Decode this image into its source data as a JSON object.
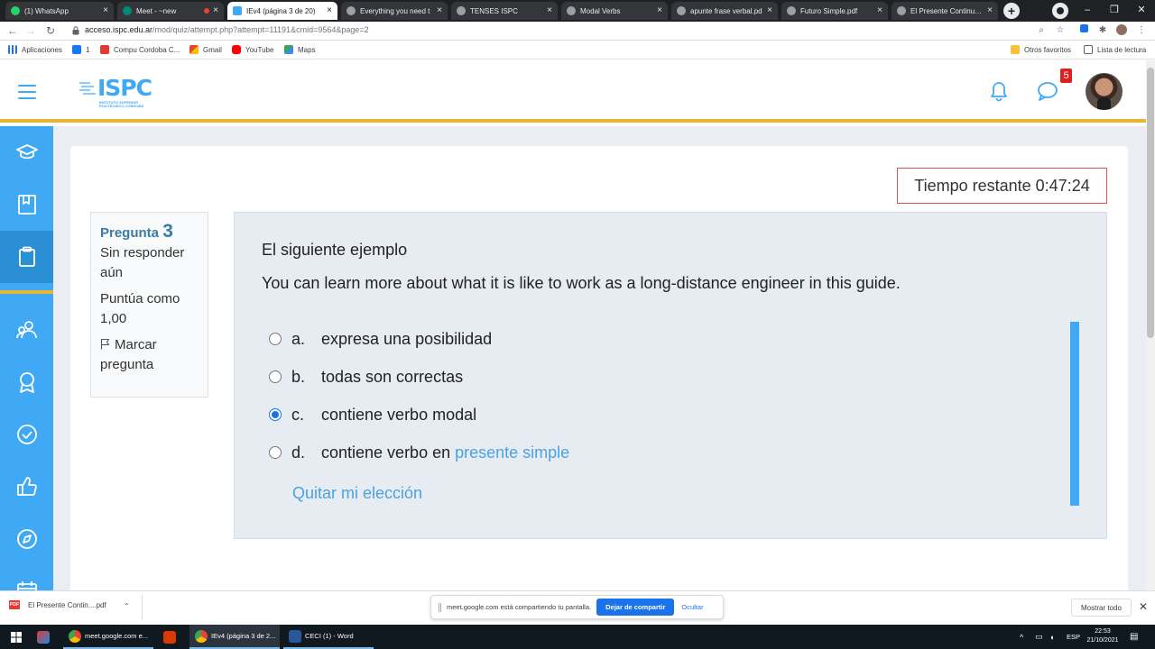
{
  "browser": {
    "tabs": [
      {
        "label": "(1) WhatsApp",
        "color": "#25d366",
        "active": false
      },
      {
        "label": "Meet - ~new",
        "color": "#00897b",
        "active": false,
        "recording": true
      },
      {
        "label": "IEv4 (página 3 de 20)",
        "color": "#3fa9f5",
        "active": true
      },
      {
        "label": "Everything you need t",
        "color": "#9aa0a6",
        "active": false
      },
      {
        "label": "TENSES ISPC",
        "color": "#9aa0a6",
        "active": false
      },
      {
        "label": "Modal Verbs",
        "color": "#9aa0a6",
        "active": false
      },
      {
        "label": "apunte frase verbal.pd",
        "color": "#9aa0a6",
        "active": false
      },
      {
        "label": "Futuro Simple.pdf",
        "color": "#9aa0a6",
        "active": false
      },
      {
        "label": "El Presente Continuo, p",
        "color": "#9aa0a6",
        "active": false
      }
    ],
    "url_host": "acceso.ispc.edu.ar",
    "url_path": "/mod/quiz/attempt.php?attempt=11191&cmid=9564&page=2",
    "bookmarks": [
      {
        "label": "Aplicaciones",
        "color": "#1a73e8"
      },
      {
        "label": "1",
        "color": "#1877f2"
      },
      {
        "label": "Compu Cordoba C...",
        "color": "#e53935"
      },
      {
        "label": "Gmail",
        "color": "#ea4335"
      },
      {
        "label": "YouTube",
        "color": "#ff0000"
      },
      {
        "label": "Maps",
        "color": "#34a853"
      }
    ],
    "other_bookmarks": "Otros favoritos",
    "reading_list": "Lista de lectura"
  },
  "site": {
    "logo_text": "ISPC",
    "logo_sub1": "INSTITUTO SUPERIOR",
    "logo_sub2": "POLITÉCNICO CÓRDOBA",
    "chat_badge": "5",
    "accent": "#3fa9f5",
    "gold": "#e7b531"
  },
  "sidebar": {
    "items": [
      {
        "name": "graduation-cap-icon"
      },
      {
        "name": "book-icon"
      },
      {
        "name": "clipboard-icon",
        "active": true
      },
      {
        "name": "users-icon"
      },
      {
        "name": "award-icon"
      },
      {
        "name": "badge-check-icon"
      },
      {
        "name": "thumbs-up-icon"
      },
      {
        "name": "compass-icon"
      },
      {
        "name": "calendar-icon"
      }
    ]
  },
  "quiz": {
    "timer_label": "Tiempo restante 0:47:24",
    "question_label": "Pregunta",
    "question_number": "3",
    "status": "Sin responder aún",
    "points": "Puntúa como 1,00",
    "flag_label": "Marcar pregunta",
    "prompt_line1": "El siguiente ejemplo",
    "prompt_line2": "You can learn more about what it is like to work as a long-distance engineer in this guide.",
    "options": [
      {
        "letter": "a.",
        "text": "expresa una posibilidad",
        "link": "",
        "checked": false
      },
      {
        "letter": "b.",
        "text": "todas son correctas",
        "link": "",
        "checked": false
      },
      {
        "letter": "c.",
        "text": "contiene verbo modal",
        "link": "",
        "checked": true
      },
      {
        "letter": "d.",
        "text": "contiene verbo en ",
        "link": "presente simple",
        "checked": false
      }
    ],
    "clear_choice": "Quitar mi elección"
  },
  "downloads": {
    "file": "El Presente Contin....pdf",
    "share_notice": "meet.google.com está compartiendo tu pantalla.",
    "stop_share": "Dejar de compartir",
    "hide": "Ocultar",
    "show_all": "Mostrar todo"
  },
  "taskbar": {
    "apps": [
      {
        "label": "meet.google.com e...",
        "color": "#fbbc04"
      },
      {
        "label": "IEv4 (página 3 de 2...",
        "color": "#fbbc04"
      },
      {
        "label": "CECI (1) - Word",
        "color": "#2b579a"
      }
    ],
    "lang": "ESP",
    "time": "22:53",
    "date": "21/10/2021"
  }
}
